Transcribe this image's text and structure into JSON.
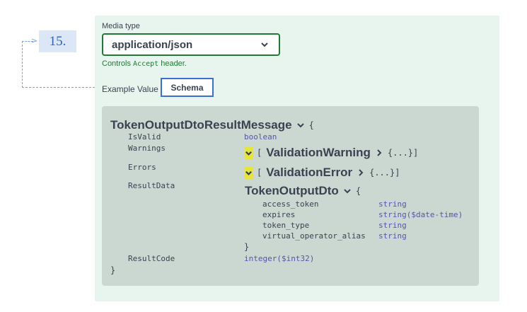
{
  "annotation": {
    "step": "15."
  },
  "media": {
    "label": "Media type",
    "selected": "application/json",
    "note_prefix": "Controls ",
    "note_code": "Accept",
    "note_suffix": " header."
  },
  "tabs": {
    "example": "Example Value",
    "schema": "Schema"
  },
  "schema": {
    "title": "TokenOutputDtoResultMessage",
    "open_brace": "{",
    "close_brace": "}",
    "fields": [
      {
        "name": "IsValid",
        "type": "boolean"
      },
      {
        "name": "Warnings",
        "model": "ValidationWarning",
        "bracket_open": "[",
        "collapsed": "{...}]"
      },
      {
        "name": "Errors",
        "model": "ValidationError",
        "bracket_open": "[",
        "collapsed": "{...}]"
      },
      {
        "name": "ResultData",
        "model": "TokenOutputDto"
      },
      {
        "name": "ResultCode",
        "type": "integer($int32)"
      }
    ],
    "nested": {
      "open_brace": "{",
      "close_brace": "}",
      "fields": [
        {
          "name": "access_token",
          "type": "string"
        },
        {
          "name": "expires",
          "type": "string($date-time)"
        },
        {
          "name": "token_type",
          "type": "string"
        },
        {
          "name": "virtual_operator_alias",
          "type": "string"
        }
      ]
    }
  },
  "colors": {
    "panel_bg": "#e8f5ee",
    "schema_bg": "#cbd8d1",
    "select_border": "#1f7a34",
    "schema_tab_border": "#3a6fd8",
    "type_color": "#5555aa",
    "highlight": "#e6e63a"
  },
  "icons": {
    "select_chevron": "chevron-down-icon",
    "expand": "chevron-down-icon",
    "collapsed": "chevron-right-icon"
  }
}
